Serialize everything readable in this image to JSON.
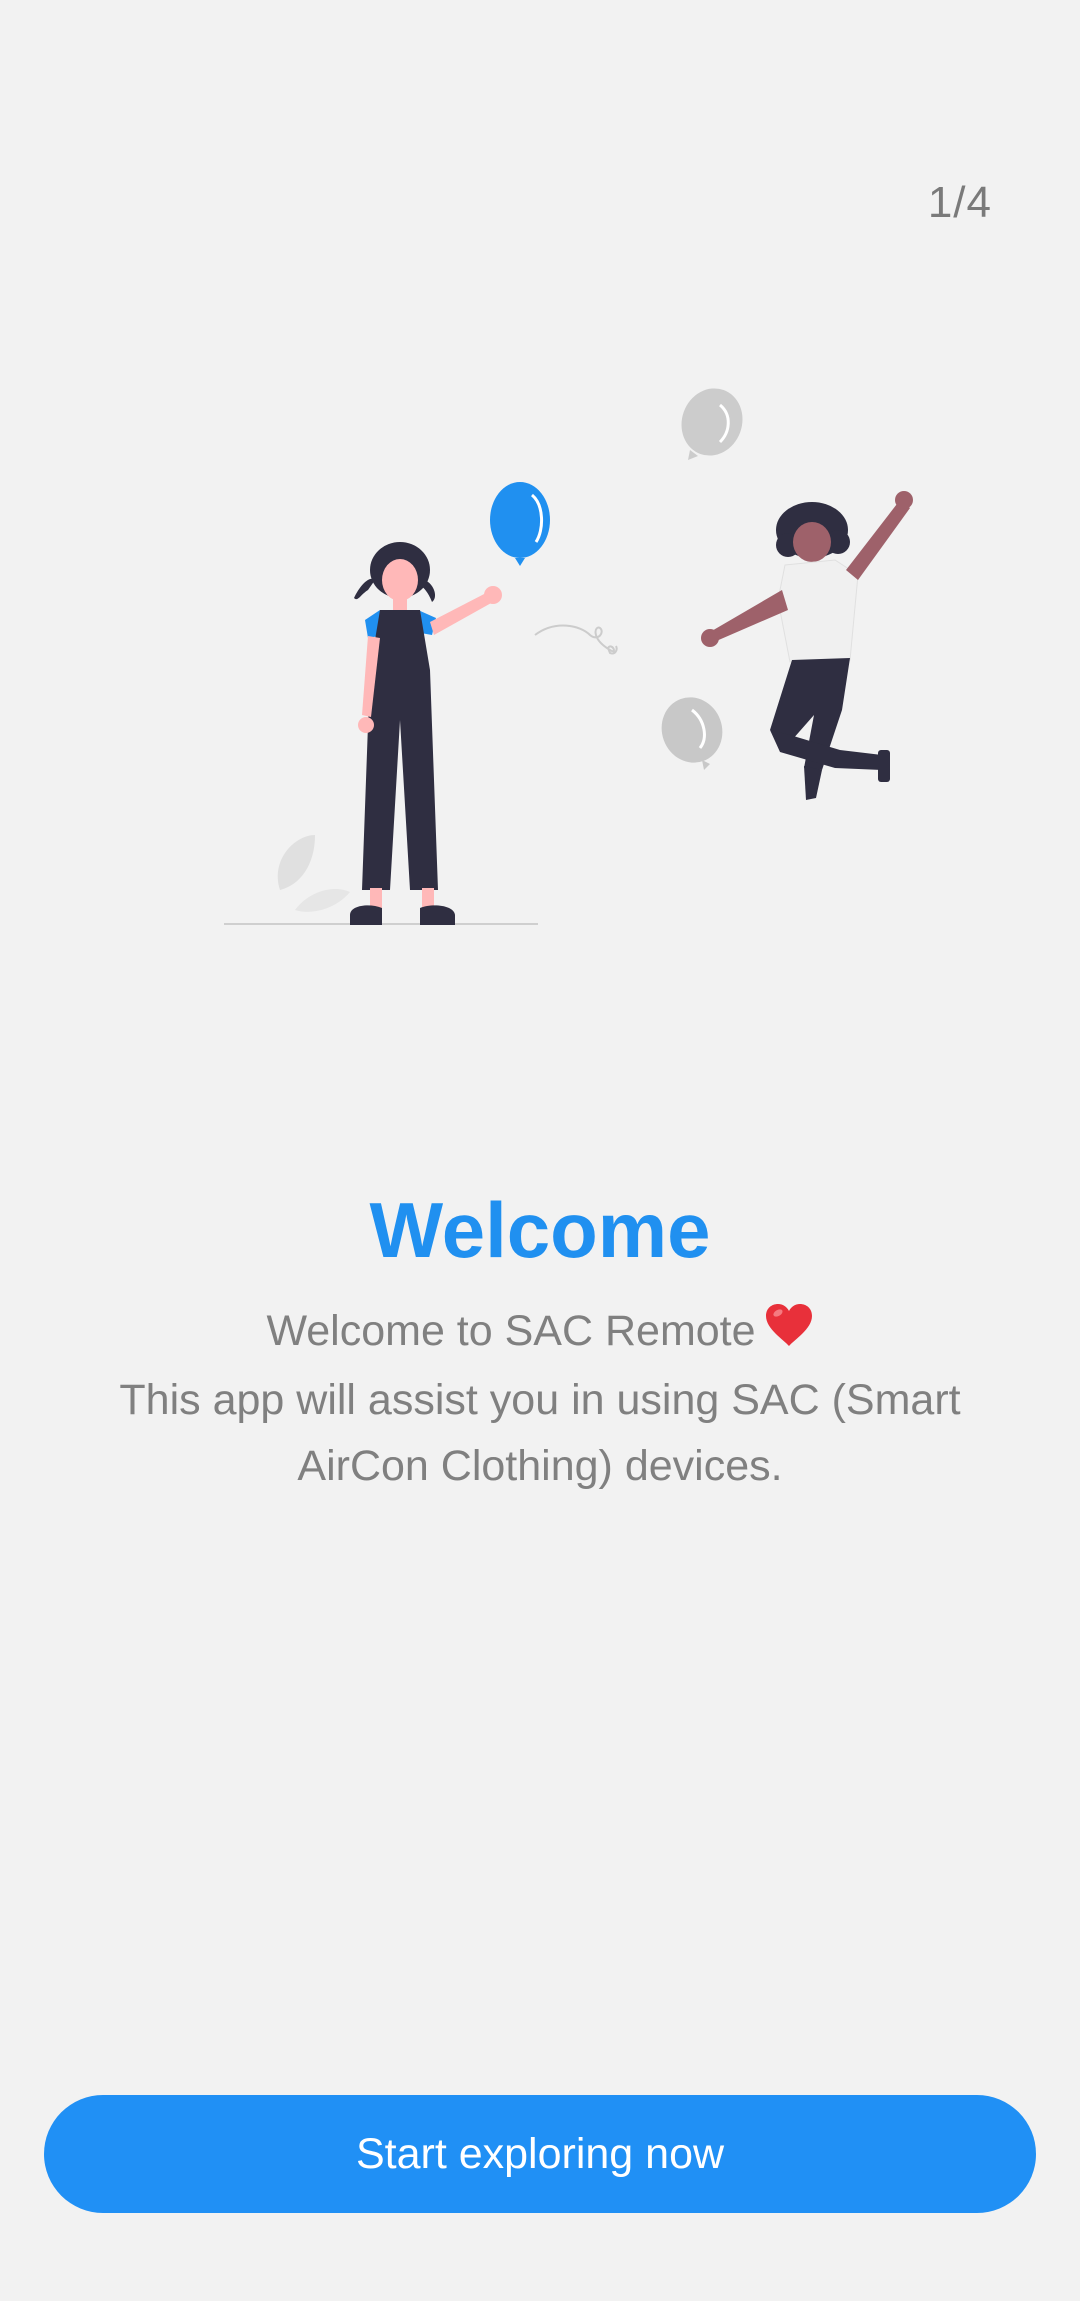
{
  "onboarding": {
    "page_indicator": "1/4",
    "title": "Welcome",
    "description_line1": "Welcome to SAC Remote",
    "description_line2": "This app will assist you in using SAC (Smart AirCon Clothing) devices.",
    "cta_label": "Start exploring now"
  },
  "colors": {
    "background": "#f2f2f2",
    "accent": "#2090f0",
    "text_muted": "#808080",
    "heart": "#e8303a"
  },
  "icons": {
    "heart": "heart-icon",
    "illustration": "celebration-illustration"
  }
}
